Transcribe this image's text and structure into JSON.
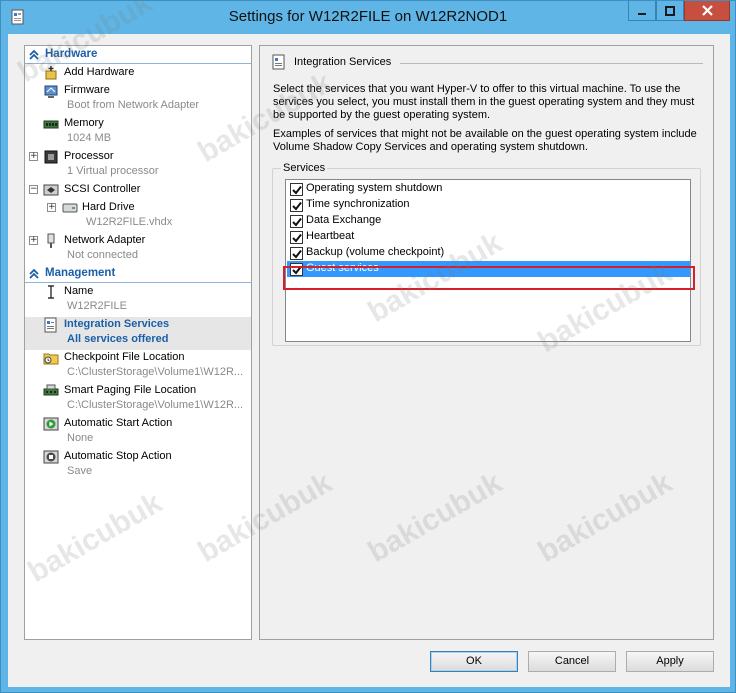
{
  "window": {
    "title": "Settings for W12R2FILE on W12R2NOD1"
  },
  "nav": {
    "hardware_header": "Hardware",
    "management_header": "Management",
    "hardware_items": [
      {
        "label": "Add Hardware",
        "sub": "",
        "icon": "add-hardware-icon"
      },
      {
        "label": "Firmware",
        "sub": "Boot from Network Adapter",
        "icon": "firmware-icon"
      },
      {
        "label": "Memory",
        "sub": "1024 MB",
        "icon": "memory-icon"
      },
      {
        "label": "Processor",
        "sub": "1 Virtual processor",
        "icon": "processor-icon",
        "expand": "+"
      },
      {
        "label": "SCSI Controller",
        "sub": "",
        "icon": "scsi-controller-icon",
        "expand": "−"
      },
      {
        "label": "Hard Drive",
        "sub": "W12R2FILE.vhdx",
        "icon": "hard-drive-icon",
        "expand": "+"
      },
      {
        "label": "Network Adapter",
        "sub": "Not connected",
        "icon": "network-adapter-icon",
        "expand": "+"
      }
    ],
    "management_items": [
      {
        "label": "Name",
        "sub": "W12R2FILE",
        "icon": "name-icon"
      },
      {
        "label": "Integration Services",
        "sub": "All services offered",
        "icon": "integration-services-icon"
      },
      {
        "label": "Checkpoint File Location",
        "sub": "C:\\ClusterStorage\\Volume1\\W12R...",
        "icon": "checkpoint-folder-icon"
      },
      {
        "label": "Smart Paging File Location",
        "sub": "C:\\ClusterStorage\\Volume1\\W12R...",
        "icon": "smart-paging-icon"
      },
      {
        "label": "Automatic Start Action",
        "sub": "None",
        "icon": "start-action-icon"
      },
      {
        "label": "Automatic Stop Action",
        "sub": "Save",
        "icon": "stop-action-icon"
      }
    ]
  },
  "content": {
    "header": "Integration Services",
    "description1": "Select the services that you want Hyper-V to offer to this virtual machine. To use the services you select, you must install them in the guest operating system and they must be supported by the guest operating system.",
    "description2": "Examples of services that might not be available on the guest operating system include Volume Shadow Copy Services and operating system shutdown.",
    "services_label": "Services",
    "services": [
      {
        "label": "Operating system shutdown",
        "checked": true
      },
      {
        "label": "Time synchronization",
        "checked": true
      },
      {
        "label": "Data Exchange",
        "checked": true
      },
      {
        "label": "Heartbeat",
        "checked": true
      },
      {
        "label": "Backup (volume checkpoint)",
        "checked": true
      },
      {
        "label": "Guest services",
        "checked": true,
        "selected": true
      }
    ]
  },
  "buttons": {
    "ok": "OK",
    "cancel": "Cancel",
    "apply": "Apply"
  },
  "watermark": "bakicubuk",
  "colors": {
    "accent": "#1a5fa8",
    "selection": "#3399ff",
    "highlight_box": "#d3202a",
    "frame": "#5fb6e6"
  }
}
